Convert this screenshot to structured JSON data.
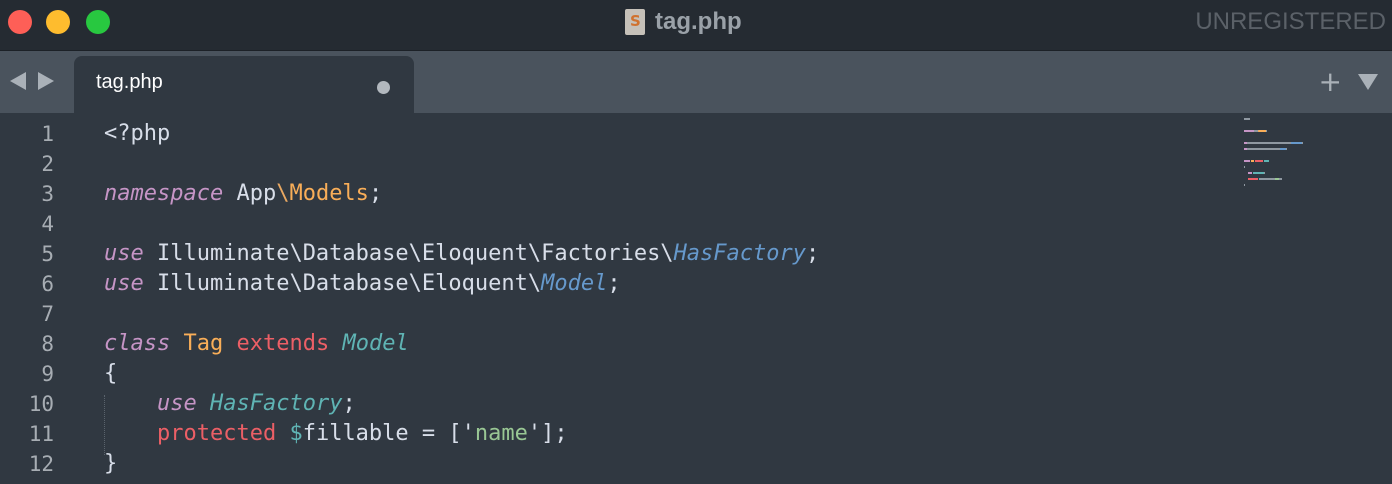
{
  "window": {
    "title": "tag.php",
    "license_status": "UNREGISTERED"
  },
  "tabs": [
    {
      "label": "tag.php",
      "modified": true
    }
  ],
  "editor": {
    "line_numbers": [
      "1",
      "2",
      "3",
      "4",
      "5",
      "6",
      "7",
      "8",
      "9",
      "10",
      "11",
      "12"
    ],
    "lines": [
      [
        {
          "t": "<?php",
          "c": "plain"
        }
      ],
      [],
      [
        {
          "t": "namespace",
          "c": "kw"
        },
        {
          "t": " App",
          "c": "plain"
        },
        {
          "t": "\\",
          "c": "bs"
        },
        {
          "t": "Models",
          "c": "ns"
        },
        {
          "t": ";",
          "c": "plain"
        }
      ],
      [],
      [
        {
          "t": "use",
          "c": "kw"
        },
        {
          "t": " Illuminate\\Database\\Eloquent\\Factories\\",
          "c": "plain"
        },
        {
          "t": "HasFactory",
          "c": "hf"
        },
        {
          "t": ";",
          "c": "plain"
        }
      ],
      [
        {
          "t": "use",
          "c": "kw"
        },
        {
          "t": " Illuminate\\Database\\Eloquent\\",
          "c": "plain"
        },
        {
          "t": "Model",
          "c": "hf"
        },
        {
          "t": ";",
          "c": "plain"
        }
      ],
      [],
      [
        {
          "t": "class",
          "c": "kw"
        },
        {
          "t": " ",
          "c": "plain"
        },
        {
          "t": "Tag",
          "c": "cls"
        },
        {
          "t": " ",
          "c": "plain"
        },
        {
          "t": "extends",
          "c": "ext"
        },
        {
          "t": " ",
          "c": "plain"
        },
        {
          "t": "Model",
          "c": "tm"
        }
      ],
      [
        {
          "t": "{",
          "c": "plain"
        }
      ],
      [
        {
          "t": "    ",
          "c": "plain"
        },
        {
          "t": "use",
          "c": "kw"
        },
        {
          "t": " ",
          "c": "plain"
        },
        {
          "t": "HasFactory",
          "c": "tm"
        },
        {
          "t": ";",
          "c": "plain"
        }
      ],
      [
        {
          "t": "    ",
          "c": "plain"
        },
        {
          "t": "protected",
          "c": "prot"
        },
        {
          "t": " ",
          "c": "plain"
        },
        {
          "t": "$",
          "c": "dol"
        },
        {
          "t": "fillable",
          "c": "plain"
        },
        {
          "t": " = [",
          "c": "plain"
        },
        {
          "t": "'",
          "c": "plain"
        },
        {
          "t": "name",
          "c": "str"
        },
        {
          "t": "'",
          "c": "plain"
        },
        {
          "t": "];",
          "c": "plain"
        }
      ],
      [
        {
          "t": "}",
          "c": "plain"
        }
      ]
    ]
  },
  "icons": {
    "close": "close-window-icon",
    "minimize": "minimize-window-icon",
    "zoom": "zoom-window-icon",
    "file": "sublime-file-icon",
    "back": "nav-back-icon",
    "forward": "nav-forward-icon",
    "new_tab": "plus-icon",
    "tab_menu": "dropdown-icon",
    "modified": "unsaved-dot-icon"
  },
  "colors": {
    "keyword": "#c695c6",
    "namespace": "#f9ae58",
    "type_hint": "#6699cc",
    "class_name": "#f9ae58",
    "extends": "#ec5f66",
    "trait": "#5fb4b4",
    "string": "#99c794",
    "background": "#303841"
  }
}
